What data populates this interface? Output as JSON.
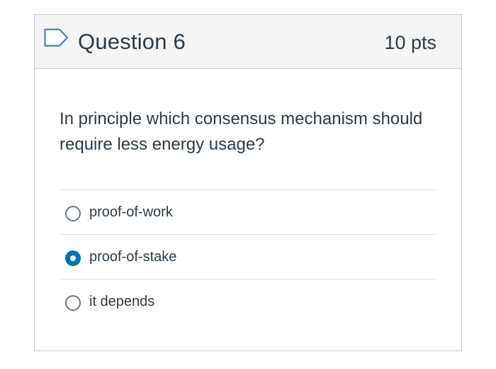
{
  "question": {
    "title": "Question 6",
    "points": "10 pts",
    "text": "In principle which consensus mechanism should require less energy usage?",
    "flag_icon": "flag-outline-icon"
  },
  "answers": [
    {
      "label": "proof-of-work",
      "selected": false
    },
    {
      "label": "proof-of-stake",
      "selected": true
    },
    {
      "label": "it depends",
      "selected": false
    }
  ],
  "colors": {
    "accent": "#0374b5",
    "header_bg": "#f5f5f5",
    "border": "#c7cdd1",
    "text": "#2d3b45",
    "flag_outline": "#4d7fb3"
  }
}
